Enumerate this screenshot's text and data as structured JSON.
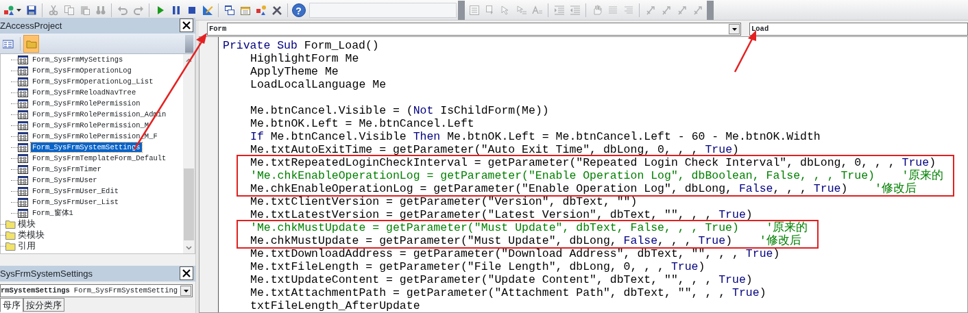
{
  "toolbars": [
    {
      "buttons": [
        {
          "kind": "insert",
          "disabled": false
        },
        {
          "kind": "save",
          "disabled": false
        },
        {
          "kind": "separator"
        },
        {
          "kind": "cut",
          "disabled": true
        },
        {
          "kind": "copy",
          "disabled": true
        },
        {
          "kind": "paste",
          "disabled": true
        },
        {
          "kind": "find",
          "disabled": true
        },
        {
          "kind": "separator"
        },
        {
          "kind": "undo",
          "disabled": true
        },
        {
          "kind": "redo",
          "disabled": true
        },
        {
          "kind": "separator"
        },
        {
          "kind": "run",
          "disabled": false
        },
        {
          "kind": "pause",
          "disabled": false
        },
        {
          "kind": "stop",
          "disabled": false
        },
        {
          "kind": "design",
          "disabled": false
        },
        {
          "kind": "separator"
        },
        {
          "kind": "project",
          "disabled": false
        },
        {
          "kind": "properties",
          "disabled": false
        },
        {
          "kind": "browser",
          "disabled": false
        },
        {
          "kind": "tools",
          "disabled": false
        },
        {
          "kind": "separator"
        },
        {
          "kind": "help",
          "label": "?",
          "disabled": false
        },
        {
          "kind": "field"
        }
      ]
    },
    {
      "buttons": [
        {
          "kind": "list",
          "disabled": true
        },
        {
          "kind": "constants",
          "disabled": true
        },
        {
          "kind": "info",
          "disabled": true
        },
        {
          "kind": "params",
          "disabled": true
        },
        {
          "kind": "complete",
          "disabled": true
        },
        {
          "kind": "separator"
        },
        {
          "kind": "indent",
          "disabled": true
        },
        {
          "kind": "outdent",
          "disabled": true
        },
        {
          "kind": "separator"
        },
        {
          "kind": "breakpoint",
          "disabled": true
        },
        {
          "kind": "comment",
          "disabled": true
        },
        {
          "kind": "uncomment",
          "disabled": true
        },
        {
          "kind": "separator"
        },
        {
          "kind": "bookmark",
          "disabled": true
        },
        {
          "kind": "bookmark",
          "disabled": true
        },
        {
          "kind": "bookmark",
          "disabled": true
        },
        {
          "kind": "bookmark",
          "disabled": true
        }
      ]
    }
  ],
  "project": {
    "title": "ZAccessProject",
    "view_buttons": [
      {
        "kind": "list",
        "selected": false
      },
      {
        "kind": "folder",
        "selected": true
      }
    ],
    "tree": [
      {
        "kind": "form",
        "label": "Form_SysFrmMySettings",
        "selected": false
      },
      {
        "kind": "form",
        "label": "Form_SysFrmOperationLog",
        "selected": false
      },
      {
        "kind": "form",
        "label": "Form_SysFrmOperationLog_List",
        "selected": false
      },
      {
        "kind": "form",
        "label": "Form_SysFrmReloadNavTree",
        "selected": false
      },
      {
        "kind": "form",
        "label": "Form_SysFrmRolePermission",
        "selected": false
      },
      {
        "kind": "form",
        "label": "Form_SysFrmRolePermission_Admin",
        "selected": false
      },
      {
        "kind": "form",
        "label": "Form_SysFrmRolePermission_M",
        "selected": false
      },
      {
        "kind": "form",
        "label": "Form_SysFrmRolePermission_M_F",
        "selected": false
      },
      {
        "kind": "form",
        "label": "Form_SysFrmSystemSettings",
        "selected": true
      },
      {
        "kind": "form",
        "label": "Form_SysFrmTemplateForm_Default",
        "selected": false
      },
      {
        "kind": "form",
        "label": "Form_SysFrmTimer",
        "selected": false
      },
      {
        "kind": "form",
        "label": "Form_SysFrmUser",
        "selected": false
      },
      {
        "kind": "form",
        "label": "Form_SysFrmUser_Edit",
        "selected": false
      },
      {
        "kind": "form",
        "label": "Form_SysFrmUser_List",
        "selected": false
      },
      {
        "kind": "form",
        "label": "Form_窗体1",
        "selected": false
      },
      {
        "kind": "folder",
        "label": "模块",
        "selected": false
      },
      {
        "kind": "folder",
        "label": "类模块",
        "selected": false
      },
      {
        "kind": "folder",
        "label": "引用",
        "selected": false
      }
    ]
  },
  "properties": {
    "title": "SysFrmSystemSettings",
    "object_name": "rmSystemSettings",
    "object_type": "Form_SysFrmSystemSetting",
    "tabs": [
      {
        "label": "母序",
        "selected": true
      },
      {
        "label": "按分类序",
        "selected": false
      }
    ]
  },
  "code": {
    "object": "Form",
    "procedure": "Load",
    "header": [
      {
        "kind": "keyword",
        "text": "Private Sub"
      },
      {
        "kind": "text",
        "text": " Form_Load()"
      }
    ],
    "blocks": [
      {
        "boxed": false,
        "lines": [
          {
            "kind": "code",
            "segments": [
              {
                "kind": "text",
                "text": "HighlightForm Me"
              }
            ]
          },
          {
            "kind": "code",
            "segments": [
              {
                "kind": "text",
                "text": "ApplyTheme Me"
              }
            ]
          },
          {
            "kind": "code",
            "segments": [
              {
                "kind": "text",
                "text": "LoadLocalLanguage Me"
              }
            ]
          },
          {
            "kind": "blank"
          },
          {
            "kind": "code",
            "segments": [
              {
                "kind": "text",
                "text": "Me.btnCancel.Visible = ("
              },
              {
                "kind": "keyword",
                "text": "Not"
              },
              {
                "kind": "text",
                "text": " IsChildForm(Me))"
              }
            ]
          },
          {
            "kind": "code",
            "segments": [
              {
                "kind": "text",
                "text": "Me.btnOK.Left = Me.btnCancel.Left"
              }
            ]
          },
          {
            "kind": "code",
            "segments": [
              {
                "kind": "keyword",
                "text": "If"
              },
              {
                "kind": "text",
                "text": " Me.btnCancel.Visible "
              },
              {
                "kind": "keyword",
                "text": "Then"
              },
              {
                "kind": "text",
                "text": " Me.btnOK.Left = Me.btnCancel.Left - 60 - Me.btnOK.Width"
              }
            ]
          },
          {
            "kind": "code",
            "segments": [
              {
                "kind": "text",
                "text": "Me.txtAutoExitTime = getParameter(\"Auto Exit Time\", dbLong, 0, , , "
              },
              {
                "kind": "keyword",
                "text": "True"
              },
              {
                "kind": "text",
                "text": ")"
              }
            ]
          }
        ]
      },
      {
        "boxed": true,
        "lines": [
          {
            "kind": "code",
            "segments": [
              {
                "kind": "text",
                "text": "Me.txtRepeatedLoginCheckInterval = getParameter(\"Repeated Login Check Interval\", dbLong, 0, , , "
              },
              {
                "kind": "keyword",
                "text": "True"
              },
              {
                "kind": "text",
                "text": ")"
              }
            ]
          },
          {
            "kind": "code",
            "segments": [
              {
                "kind": "comment",
                "text": "'Me.chkEnableOperationLog = getParameter(\"Enable Operation Log\", dbBoolean, False, , , True)    '原来的"
              }
            ]
          },
          {
            "kind": "code",
            "segments": [
              {
                "kind": "text",
                "text": "Me.chkEnableOperationLog = getParameter(\"Enable Operation Log\", dbLong, "
              },
              {
                "kind": "keyword",
                "text": "False"
              },
              {
                "kind": "text",
                "text": ", , , "
              },
              {
                "kind": "keyword",
                "text": "True"
              },
              {
                "kind": "text",
                "text": ")"
              },
              {
                "kind": "comment",
                "text": "    '修改后"
              }
            ]
          }
        ]
      },
      {
        "boxed": false,
        "lines": [
          {
            "kind": "code",
            "segments": [
              {
                "kind": "text",
                "text": "Me.txtClientVersion = getParameter(\"Version\", dbText, \"\")"
              }
            ]
          },
          {
            "kind": "code",
            "segments": [
              {
                "kind": "text",
                "text": "Me.txtLatestVersion = getParameter(\"Latest Version\", dbText, \"\", , , "
              },
              {
                "kind": "keyword",
                "text": "True"
              },
              {
                "kind": "text",
                "text": ")"
              }
            ]
          }
        ]
      },
      {
        "boxed": true,
        "lines": [
          {
            "kind": "code",
            "segments": [
              {
                "kind": "comment",
                "text": "'Me.chkMustUpdate = getParameter(\"Must Update\", dbText, False, , , True)    '原来的"
              }
            ]
          },
          {
            "kind": "code",
            "segments": [
              {
                "kind": "text",
                "text": "Me.chkMustUpdate = getParameter(\"Must Update\", dbLong, "
              },
              {
                "kind": "keyword",
                "text": "False"
              },
              {
                "kind": "text",
                "text": ", , , "
              },
              {
                "kind": "keyword",
                "text": "True"
              },
              {
                "kind": "text",
                "text": ")"
              },
              {
                "kind": "comment",
                "text": "    '修改后"
              }
            ]
          }
        ]
      },
      {
        "boxed": false,
        "lines": [
          {
            "kind": "code",
            "segments": [
              {
                "kind": "text",
                "text": "Me.txtDownloadAddress = getParameter(\"Download Address\", dbText, \"\", , , "
              },
              {
                "kind": "keyword",
                "text": "True"
              },
              {
                "kind": "text",
                "text": ")"
              }
            ]
          },
          {
            "kind": "code",
            "segments": [
              {
                "kind": "text",
                "text": "Me.txtFileLength = getParameter(\"File Length\", dbLong, 0, , , "
              },
              {
                "kind": "keyword",
                "text": "True"
              },
              {
                "kind": "text",
                "text": ")"
              }
            ]
          },
          {
            "kind": "code",
            "segments": [
              {
                "kind": "text",
                "text": "Me.txtUpdateContent = getParameter(\"Update Content\", dbText, \"\", , , "
              },
              {
                "kind": "keyword",
                "text": "True"
              },
              {
                "kind": "text",
                "text": ")"
              }
            ]
          },
          {
            "kind": "code",
            "segments": [
              {
                "kind": "text",
                "text": "Me.txtAttachmentPath = getParameter(\"Attachment Path\", dbText, \"\", , , "
              },
              {
                "kind": "keyword",
                "text": "True"
              },
              {
                "kind": "text",
                "text": ")"
              }
            ]
          },
          {
            "kind": "code",
            "segments": [
              {
                "kind": "text",
                "text": "txtFileLength_AfterUpdate"
              }
            ]
          }
        ]
      }
    ]
  }
}
